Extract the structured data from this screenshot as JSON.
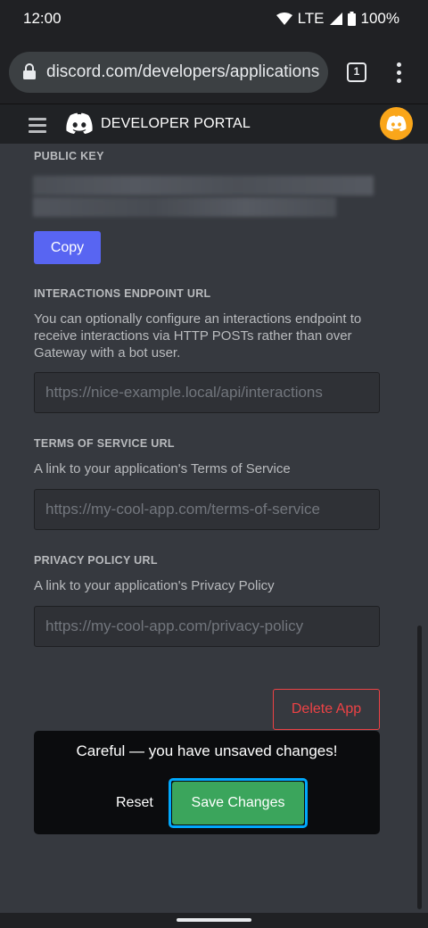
{
  "status_bar": {
    "time": "12:00",
    "network": "LTE",
    "battery": "100%"
  },
  "browser": {
    "url": "discord.com/developers/applications",
    "tab_count": "1"
  },
  "header": {
    "title": "DEVELOPER PORTAL"
  },
  "public_key": {
    "label": "PUBLIC KEY",
    "copy_label": "Copy"
  },
  "interactions": {
    "label": "INTERACTIONS ENDPOINT URL",
    "description": "You can optionally configure an interactions endpoint to receive interactions via HTTP POSTs rather than over Gateway with a bot user.",
    "placeholder": "https://nice-example.local/api/interactions"
  },
  "terms": {
    "label": "TERMS OF SERVICE URL",
    "description": "A link to your application's Terms of Service",
    "placeholder": "https://my-cool-app.com/terms-of-service"
  },
  "privacy": {
    "label": "PRIVACY POLICY URL",
    "description": "A link to your application's Privacy Policy",
    "placeholder": "https://my-cool-app.com/privacy-policy"
  },
  "delete_label": "Delete App",
  "unsaved": {
    "message": "Careful — you have unsaved changes!",
    "reset_label": "Reset",
    "save_label": "Save Changes"
  },
  "colors": {
    "blurple": "#5865f2",
    "danger": "#ed4245",
    "success": "#3ba55c",
    "focus": "#00a8fc",
    "avatar": "#faa61a"
  }
}
